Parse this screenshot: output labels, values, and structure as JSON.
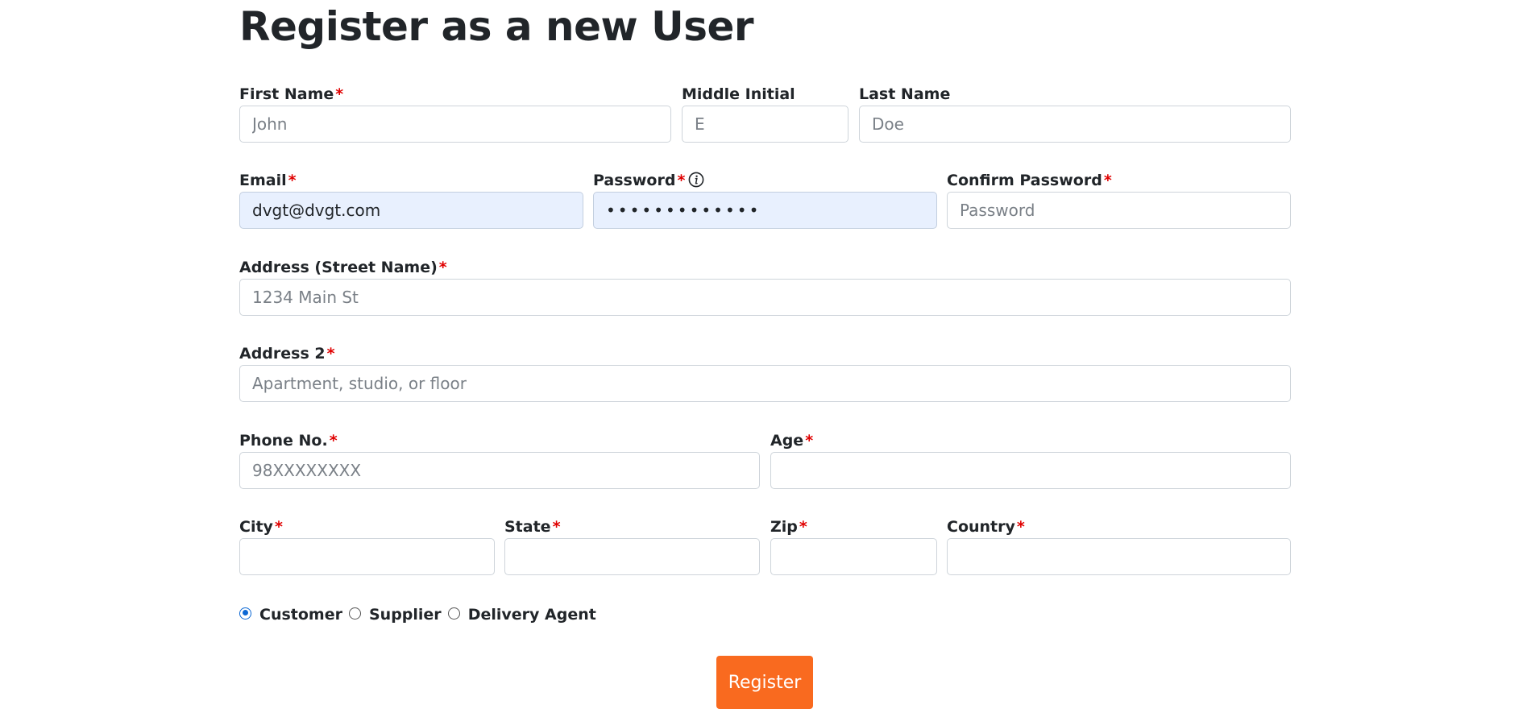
{
  "page_title": "Register as a new User",
  "required_marker": "*",
  "fields": {
    "first_name": {
      "label": "First Name",
      "placeholder": "John",
      "value": ""
    },
    "middle_initial": {
      "label": "Middle Initial",
      "placeholder": "E",
      "value": ""
    },
    "last_name": {
      "label": "Last Name",
      "placeholder": "Doe",
      "value": ""
    },
    "email": {
      "label": "Email",
      "placeholder": "",
      "value": "dvgt@dvgt.com"
    },
    "password": {
      "label": "Password",
      "placeholder": "",
      "value": "•••••••••••••"
    },
    "confirm_password": {
      "label": "Confirm Password",
      "placeholder": "Password",
      "value": ""
    },
    "address": {
      "label": "Address (Street Name)",
      "placeholder": "1234 Main St",
      "value": ""
    },
    "address2": {
      "label": "Address 2",
      "placeholder": "Apartment, studio, or floor",
      "value": ""
    },
    "phone": {
      "label": "Phone No.",
      "placeholder": "98XXXXXXXX",
      "value": ""
    },
    "age": {
      "label": "Age",
      "placeholder": "",
      "value": ""
    },
    "city": {
      "label": "City",
      "placeholder": "",
      "value": ""
    },
    "state": {
      "label": "State",
      "placeholder": "",
      "value": ""
    },
    "zip": {
      "label": "Zip",
      "placeholder": "",
      "value": ""
    },
    "country": {
      "label": "Country",
      "placeholder": "",
      "value": ""
    }
  },
  "user_type": {
    "options": [
      "Customer",
      "Supplier",
      "Delivery Agent"
    ],
    "selected": "Customer"
  },
  "register_button": "Register",
  "colors": {
    "required": "#e00000",
    "button": "#f96a1f",
    "autofill": "#e8f0fe",
    "radio_checked": "#0b67d4"
  },
  "icons": {
    "password_info": "info-circle-icon"
  }
}
